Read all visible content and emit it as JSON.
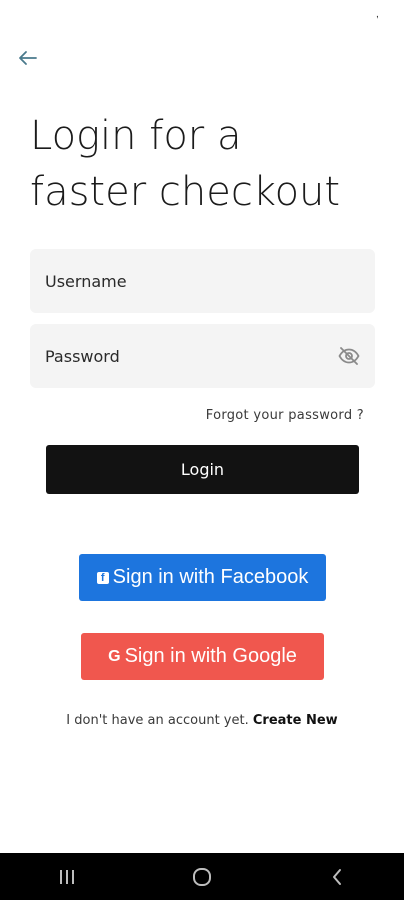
{
  "status_bar": {
    "indicator": ","
  },
  "header": {
    "back_icon": "arrow-left-icon",
    "title_line1": "Login for a",
    "title_line2": "faster checkout"
  },
  "form": {
    "username_placeholder": "Username",
    "password_placeholder": "Password",
    "password_toggle_icon": "eye-off-icon",
    "forgot_password": "Forgot your password ?",
    "login_label": "Login"
  },
  "social": {
    "facebook_label": "Sign in with Facebook",
    "facebook_icon": "facebook-icon",
    "google_label": "Sign in with Google",
    "google_icon": "google-icon",
    "google_icon_glyph": "G",
    "facebook_icon_glyph": "f"
  },
  "signup": {
    "prompt": "I don't have an account yet.",
    "create_label": "Create New"
  },
  "nav": {
    "recents_icon": "recent-apps-icon",
    "home_icon": "home-icon",
    "back_icon": "back-chevron-icon"
  },
  "colors": {
    "facebook": "#1d75de",
    "google": "#f0574e",
    "login_button": "#121212",
    "field_background": "#f4f4f4",
    "accent_back_arrow": "#4a7a8c"
  }
}
